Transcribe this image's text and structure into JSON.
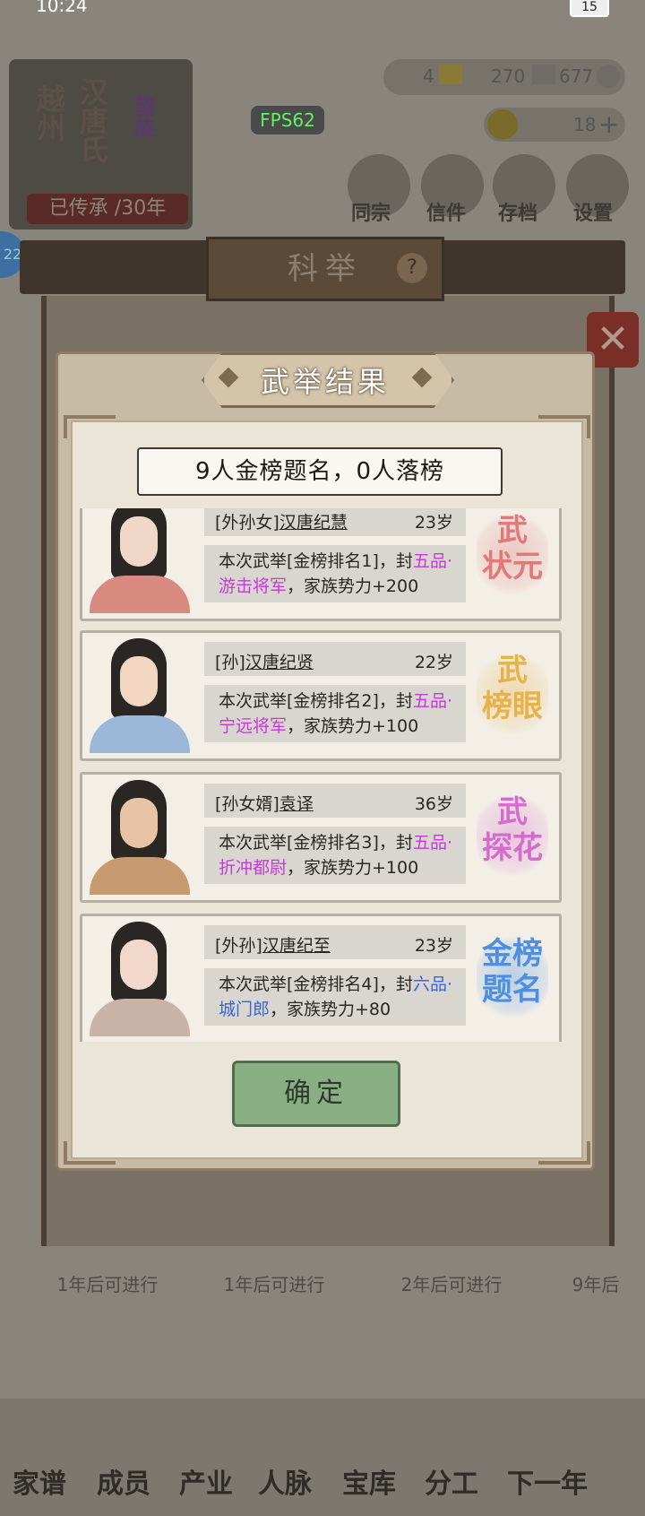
{
  "status": {
    "time": "10:24",
    "battery": "15"
  },
  "fps": "FPS62",
  "resources": {
    "gold": "4",
    "silver": "270",
    "coin": "677",
    "food": "18"
  },
  "family": {
    "region": "越州",
    "clan": "汉唐氏",
    "tag": "望族",
    "years": "已传承 /30年"
  },
  "top_menu": [
    "同宗",
    "信件",
    "存档",
    "设置"
  ],
  "badge": "22",
  "panel_title": "科举",
  "modal": {
    "title": "武举结果",
    "summary": "9人金榜题名，0人落榜",
    "confirm": "确定",
    "results": [
      {
        "relation": "[外孙女]",
        "name": "汉唐纪慧",
        "age": "23岁",
        "desc_pre": "本次武举[金榜排名1]，封",
        "rank_grade": "五",
        "rank_title": "品·游击将军",
        "desc_post": "，家族势力+200",
        "stamp": "武状元",
        "stamp_color": "#e07a7a",
        "rank_color": "purple"
      },
      {
        "relation": "[孙]",
        "name": "汉唐纪贤",
        "age": "22岁",
        "desc_pre": "本次武举[金榜排名2]，封",
        "rank_grade": "五",
        "rank_title": "品·宁远将军",
        "desc_post": "，家族势力+100",
        "stamp": "武榜眼",
        "stamp_color": "#e6b24a",
        "rank_color": "purple"
      },
      {
        "relation": "[孙女婿]",
        "name": "袁译",
        "age": "36岁",
        "desc_pre": "本次武举[金榜排名3]，封",
        "rank_grade": "五",
        "rank_title": "品·折冲都尉",
        "desc_post": "，家族势力+100",
        "stamp": "武探花",
        "stamp_color": "#d46ccc",
        "rank_color": "purple"
      },
      {
        "relation": "[外孙]",
        "name": "汉唐纪至",
        "age": "23岁",
        "desc_pre": "本次武举[金榜排名4]，封",
        "rank_grade": "六",
        "rank_title": "品·城门郎",
        "desc_post": "，家族势力+80",
        "stamp": "金榜题名",
        "stamp_color": "#4f8fe0",
        "rank_color": "blue"
      }
    ]
  },
  "bottom_cells": [
    "1年后可进行",
    "1年后可进行",
    "2年后可进行",
    "9年后"
  ],
  "bottom_nav": [
    "家谱",
    "成员",
    "产业",
    "人脉",
    "宝库",
    "分工",
    "下一年"
  ]
}
